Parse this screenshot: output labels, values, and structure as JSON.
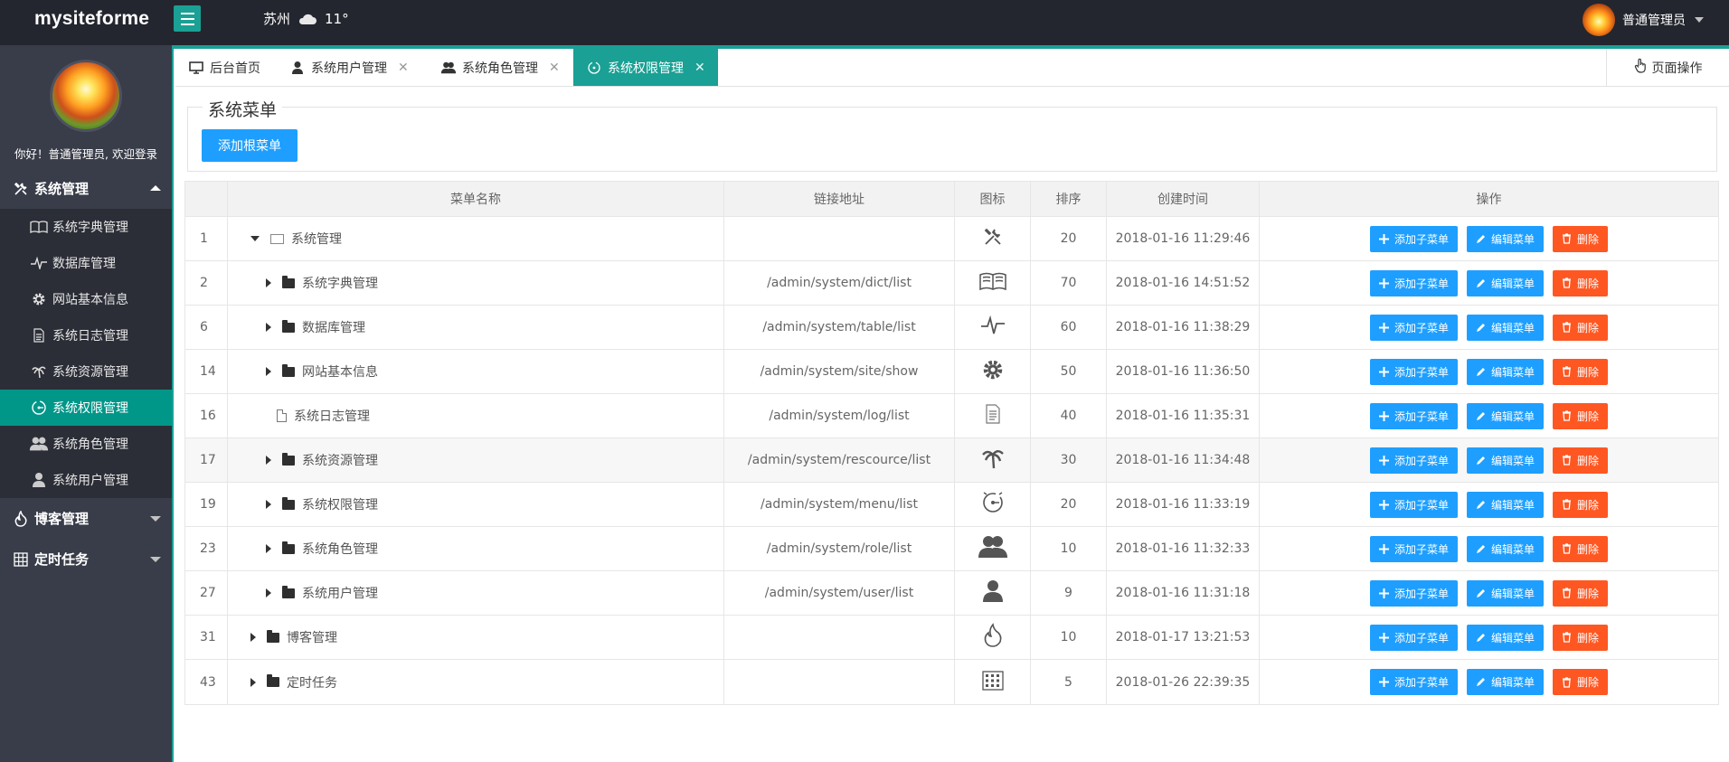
{
  "header": {
    "logo": "mysiteforme",
    "city": "苏州",
    "temperature": "11°",
    "username": "普通管理员"
  },
  "sidebar": {
    "welcome": "你好！普通管理员, 欢迎登录",
    "groups": [
      {
        "label": "系统管理",
        "icon": "wrench-icon"
      },
      {
        "label": "博客管理",
        "icon": "fire-icon"
      },
      {
        "label": "定时任务",
        "icon": "grid-icon"
      }
    ],
    "items": [
      {
        "label": "系统字典管理",
        "icon": "book-icon"
      },
      {
        "label": "数据库管理",
        "icon": "pulse-icon"
      },
      {
        "label": "网站基本信息",
        "icon": "gear-icon"
      },
      {
        "label": "系统日志管理",
        "icon": "document-icon"
      },
      {
        "label": "系统资源管理",
        "icon": "palm-icon"
      },
      {
        "label": "系统权限管理",
        "icon": "dial-icon"
      },
      {
        "label": "系统角色管理",
        "icon": "users-icon"
      },
      {
        "label": "系统用户管理",
        "icon": "user-icon"
      }
    ]
  },
  "tabs": [
    {
      "label": "后台首页",
      "icon": "monitor-icon"
    },
    {
      "label": "系统用户管理",
      "icon": "user-icon"
    },
    {
      "label": "系统角色管理",
      "icon": "users-icon"
    },
    {
      "label": "系统权限管理",
      "icon": "dial-icon"
    }
  ],
  "page_ops": "页面操作",
  "section": {
    "legend": "系统菜单",
    "add_root": "添加根菜单"
  },
  "table": {
    "headers": [
      "菜单名称",
      "链接地址",
      "图标",
      "排序",
      "创建时间",
      "操作"
    ],
    "actions": {
      "add_child": "添加子菜单",
      "edit": "编辑菜单",
      "delete": "删除"
    },
    "rows": [
      {
        "id": "1",
        "name": "系统管理",
        "url": "",
        "icon": "wrench-icon",
        "sort": "20",
        "created": "2018-01-16 11:29:46"
      },
      {
        "id": "2",
        "name": "系统字典管理",
        "url": "/admin/system/dict/list",
        "icon": "book-icon",
        "sort": "70",
        "created": "2018-01-16 14:51:52"
      },
      {
        "id": "6",
        "name": "数据库管理",
        "url": "/admin/system/table/list",
        "icon": "pulse-icon",
        "sort": "60",
        "created": "2018-01-16 11:38:29"
      },
      {
        "id": "14",
        "name": "网站基本信息",
        "url": "/admin/system/site/show",
        "icon": "gear-icon",
        "sort": "50",
        "created": "2018-01-16 11:36:50"
      },
      {
        "id": "16",
        "name": "系统日志管理",
        "url": "/admin/system/log/list",
        "icon": "document-icon",
        "sort": "40",
        "created": "2018-01-16 11:35:31"
      },
      {
        "id": "17",
        "name": "系统资源管理",
        "url": "/admin/system/rescource/list",
        "icon": "palm-icon",
        "sort": "30",
        "created": "2018-01-16 11:34:48"
      },
      {
        "id": "19",
        "name": "系统权限管理",
        "url": "/admin/system/menu/list",
        "icon": "dial-icon",
        "sort": "20",
        "created": "2018-01-16 11:33:19"
      },
      {
        "id": "23",
        "name": "系统角色管理",
        "url": "/admin/system/role/list",
        "icon": "users-icon",
        "sort": "10",
        "created": "2018-01-16 11:32:33"
      },
      {
        "id": "27",
        "name": "系统用户管理",
        "url": "/admin/system/user/list",
        "icon": "user-icon",
        "sort": "9",
        "created": "2018-01-16 11:31:18"
      },
      {
        "id": "31",
        "name": "博客管理",
        "url": "",
        "icon": "fire-icon",
        "sort": "10",
        "created": "2018-01-17 13:21:53"
      },
      {
        "id": "43",
        "name": "定时任务",
        "url": "",
        "icon": "grid-icon",
        "sort": "5",
        "created": "2018-01-26 22:39:35"
      }
    ]
  },
  "colors": {
    "header_bg": "#23262e",
    "sidebar_bg": "#393d49",
    "accent": "#1aa094",
    "active_item": "#009688",
    "primary_button": "#1e9fff",
    "danger_button": "#ff5722"
  }
}
